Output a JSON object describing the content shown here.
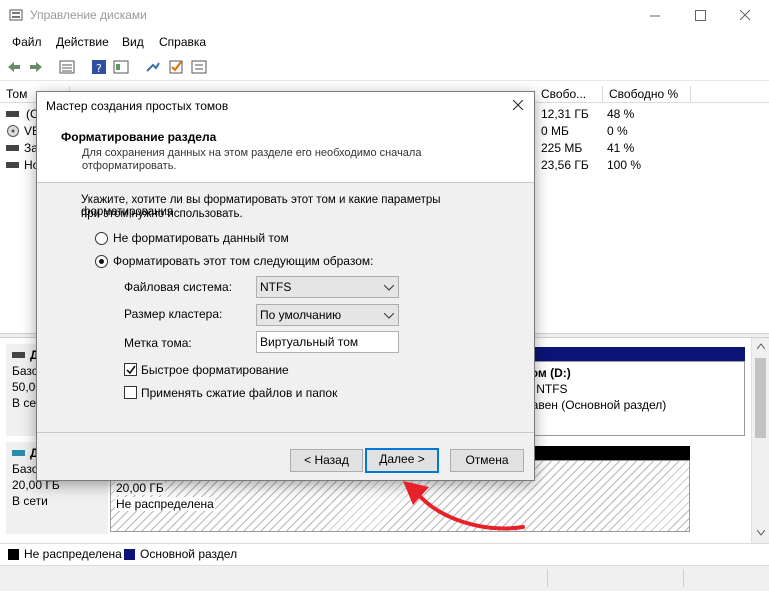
{
  "window": {
    "title": "Управление дисками",
    "icon": "disk-management-icon",
    "controls": [
      "minimize-icon",
      "maximize-icon",
      "close-icon"
    ]
  },
  "menu": [
    "Файл",
    "Действие",
    "Вид",
    "Справка"
  ],
  "toolbar": [
    "back-icon",
    "forward-icon",
    "list-view-icon",
    "help-icon",
    "properties-icon",
    "connect-icon",
    "check-icon",
    "settings-icon"
  ],
  "volume_list": {
    "headers": [
      "Том",
      "Свобо...",
      "Свободно %"
    ],
    "rows": [
      {
        "name": "(C",
        "free": "12,31 ГБ",
        "free_pct": "48 %"
      },
      {
        "name": "VB",
        "free": "0 МБ",
        "free_pct": "0 %"
      },
      {
        "name": "За",
        "free": "225 МБ",
        "free_pct": "41 %"
      },
      {
        "name": "Но",
        "free": "23,56 ГБ",
        "free_pct": "100 %"
      }
    ]
  },
  "disks": [
    {
      "label": "Д",
      "type": "Базо",
      "size": "50,00",
      "status": "В сет",
      "volume": {
        "title": "том (D:)",
        "fs": "Б NTFS",
        "status": "равен (Основной раздел)"
      }
    },
    {
      "label": "Д",
      "type": "Базо",
      "size": "20,00 ГБ",
      "status": "В сети",
      "volume": {
        "size": "20,00 ГБ",
        "status": "Не распределена"
      }
    }
  ],
  "legend": {
    "items": [
      {
        "label": "Не распределена",
        "color": "#000000"
      },
      {
        "label": "Основной раздел",
        "color": "#0c1478"
      }
    ]
  },
  "dialog": {
    "title": "Мастер создания простых томов",
    "header_title": "Форматирование раздела",
    "header_desc_line1": "Для сохранения данных на этом разделе его необходимо сначала",
    "header_desc_line2": "отформатировать.",
    "intro_line1": "Укажите, хотите ли вы форматировать этот том и какие параметры форматирования",
    "intro_line2": "при этом нужно использовать.",
    "option_no_format": "Не форматировать данный том",
    "option_format": "Форматировать этот том следующим образом:",
    "selected_option": "format",
    "fs_label": "Файловая система:",
    "fs_value": "NTFS",
    "cluster_label": "Размер кластера:",
    "cluster_value": "По умолчанию",
    "volume_label_label": "Метка тома:",
    "volume_label_value": "Виртуальный том",
    "quick_format_label": "Быстрое форматирование",
    "quick_format_checked": true,
    "compression_label": "Применять сжатие файлов и папок",
    "compression_checked": false,
    "back_button": "< Назад",
    "next_button": "Далее >",
    "cancel_button": "Отмена"
  },
  "annotation": {
    "color": "#e8202a",
    "target": "next-button"
  }
}
